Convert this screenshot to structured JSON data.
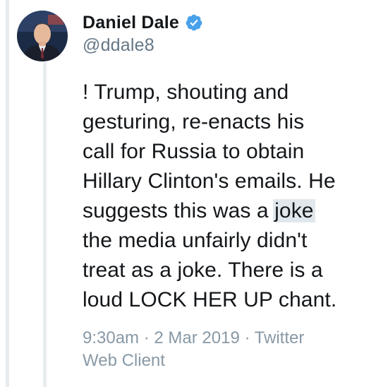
{
  "author": {
    "display_name": "Daniel Dale",
    "handle": "@ddale8",
    "verified": true,
    "verified_color": "#4aa1eb"
  },
  "tweet": {
    "lines": [
      "! Trump, shouting and",
      "gesturing, re-enacts his",
      "call for Russia to obtain",
      "Hillary Clinton's emails. He",
      "suggests this was a ",
      "the media unfairly didn't",
      "treat as a joke. There is a",
      "loud LOCK HER UP chant."
    ],
    "highlighted_word": "joke"
  },
  "meta": {
    "line1": "9:30am · 2 Mar 2019 · Twitter",
    "line2": "Web Client"
  },
  "colors": {
    "text": "#14171a",
    "secondary": "#657786",
    "meta": "#8899a6",
    "highlight_bg": "#e1e8ed"
  }
}
